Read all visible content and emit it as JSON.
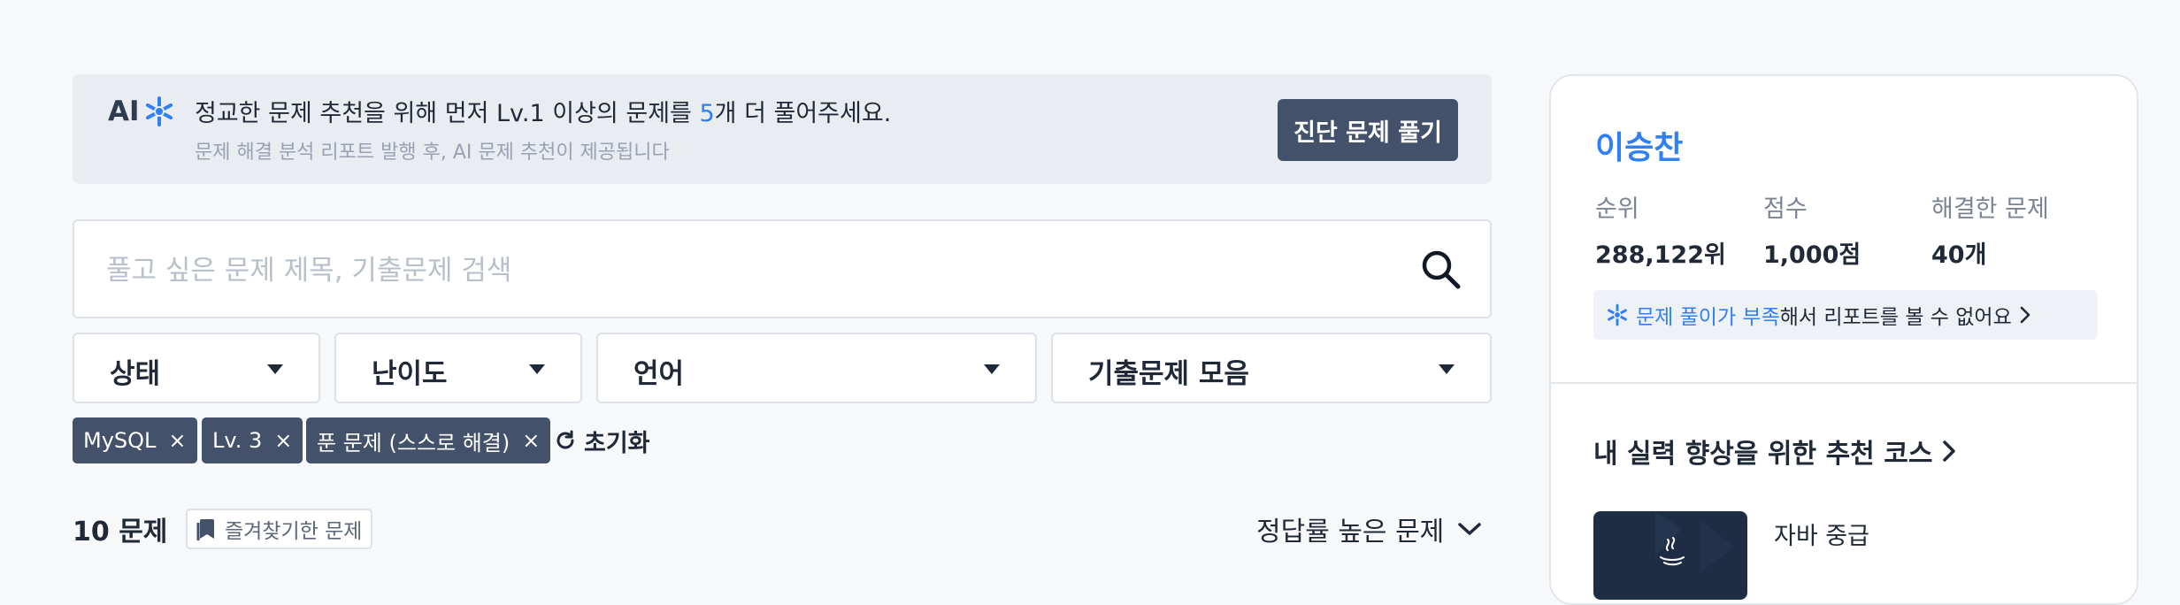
{
  "ai_banner": {
    "logo_text": "AI",
    "message_prefix": "정교한 문제 추천을 위해 먼저 Lv.1 이상의 문제를 ",
    "message_count": "5",
    "message_suffix": "개 더 풀어주세요.",
    "sub_message": "문제 해결 분석 리포트 발행 후, AI 문제 추천이 제공됩니다",
    "button_label": "진단 문제 풀기"
  },
  "search": {
    "placeholder": "풀고 싶은 문제 제목, 기출문제 검색",
    "value": ""
  },
  "filters": [
    {
      "label": "상태"
    },
    {
      "label": "난이도"
    },
    {
      "label": "언어"
    },
    {
      "label": "기출문제 모음"
    }
  ],
  "active_tags": [
    {
      "label": "MySQL",
      "remove": "×"
    },
    {
      "label": "Lv. 3",
      "remove": "×"
    },
    {
      "label": "푼 문제 (스스로 해결)",
      "remove": "×"
    }
  ],
  "reset_label": "초기화",
  "results": {
    "count_label": "10 문제",
    "bookmark_label": "즐겨찾기한 문제",
    "sort_label": "정답률 높은 문제"
  },
  "profile": {
    "name": "이승찬",
    "stats": [
      {
        "label": "순위",
        "value": "288,122위"
      },
      {
        "label": "점수",
        "value": "1,000점"
      },
      {
        "label": "해결한 문제",
        "value": "40개"
      }
    ],
    "report_notice_highlight": "문제 풀이가 부족",
    "report_notice_rest": "해서 리포트를 볼 수 없어요"
  },
  "courses": {
    "title": "내 실력 향상을 위한 추천 코스",
    "items": [
      {
        "name": "자바 중급"
      }
    ]
  },
  "colors": {
    "accent": "#2f7ff5",
    "button_dark": "#44516a",
    "banner_bg": "#e9ecf1",
    "page_bg": "#f7f8fa"
  },
  "icons": [
    "ai-sparkle-icon",
    "search-icon",
    "chevron-down-icon",
    "close-icon",
    "refresh-icon",
    "bookmark-icon",
    "chevron-right-icon",
    "java-logo-icon"
  ]
}
